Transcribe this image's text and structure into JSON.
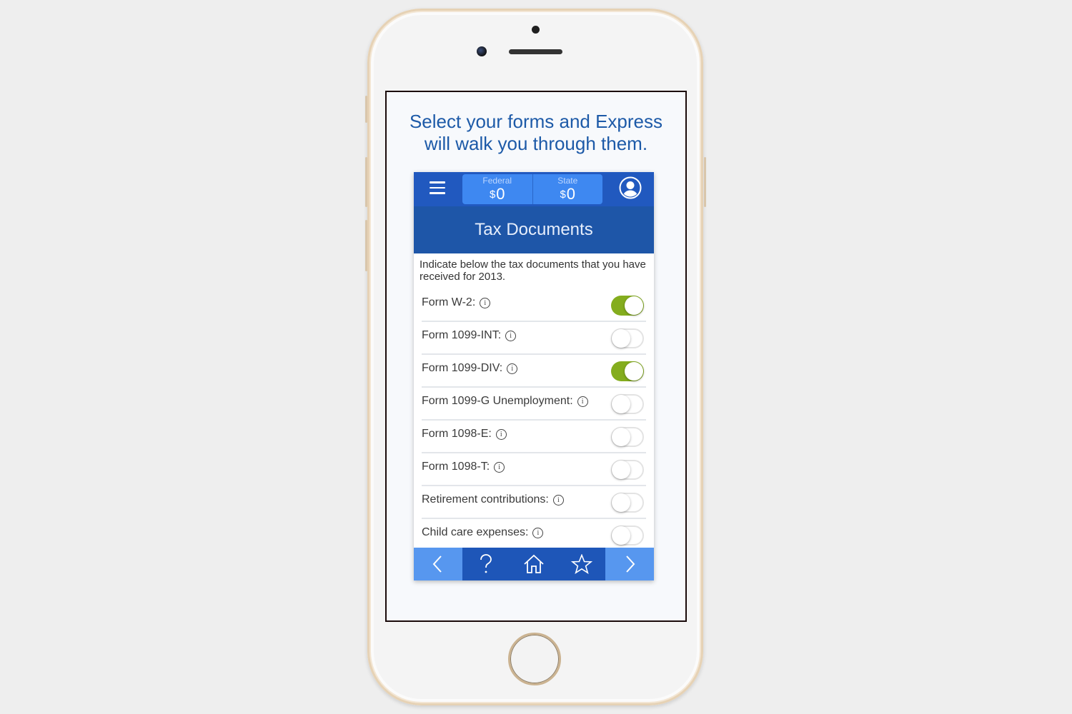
{
  "headline": {
    "line1": "Select your forms and Express",
    "line2": "will walk you through them."
  },
  "app": {
    "topbar": {
      "menu_icon": "hamburger-menu-icon",
      "federal": {
        "label": "Federal",
        "currency": "$",
        "value": "0"
      },
      "state": {
        "label": "State",
        "currency": "$",
        "value": "0"
      },
      "profile_icon": "user-avatar-icon"
    },
    "title": "Tax Documents",
    "intro": "Indicate below the tax documents that you have received for 2013.",
    "info_glyph": "i",
    "forms": [
      {
        "label": "Form W-2:",
        "enabled": true
      },
      {
        "label": "Form 1099-INT:",
        "enabled": false
      },
      {
        "label": "Form 1099-DIV:",
        "enabled": true
      },
      {
        "label": "Form 1099-G Unemployment:",
        "enabled": false
      },
      {
        "label": "Form 1098-E:",
        "enabled": false
      },
      {
        "label": "Form 1098-T:",
        "enabled": false
      },
      {
        "label": "Retirement contributions:",
        "enabled": false
      },
      {
        "label": "Child care expenses:",
        "enabled": false
      }
    ],
    "bottom_nav": [
      {
        "name": "back",
        "icon": "chevron-left-icon"
      },
      {
        "name": "help",
        "icon": "question-mark-icon"
      },
      {
        "name": "home",
        "icon": "home-icon"
      },
      {
        "name": "favorites",
        "icon": "star-icon"
      },
      {
        "name": "next",
        "icon": "chevron-right-icon"
      }
    ]
  },
  "colors": {
    "headline": "#1d5aa8",
    "topbar": "#2159bf",
    "amount_box": "#3e88f1",
    "title_bar": "#1e56a8",
    "toggle_on": "#84ad1e",
    "bottom_bar": "#1e56b8",
    "bottom_edge": "#5797ef"
  }
}
